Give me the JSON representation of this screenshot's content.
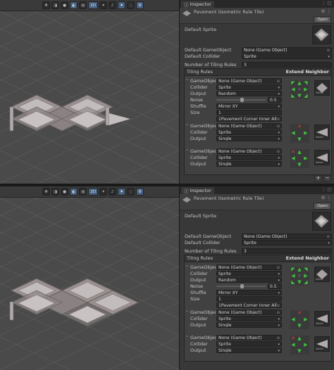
{
  "toolbar": {
    "buttons": [
      {
        "icon": "move-icon",
        "glyph": "✥"
      },
      {
        "icon": "draw-mode-icon",
        "glyph": "◨"
      },
      {
        "icon": "sphere-icon",
        "glyph": "●"
      },
      {
        "icon": "moon-icon",
        "glyph": "◐"
      },
      {
        "icon": "layers-icon",
        "glyph": "▤"
      },
      {
        "label": "2D"
      },
      {
        "icon": "lighting-icon",
        "glyph": "✦"
      },
      {
        "icon": "audio-icon",
        "glyph": "♪"
      },
      {
        "icon": "fx-icon",
        "glyph": "✷"
      },
      {
        "icon": "hidden-icon",
        "glyph": "◌"
      },
      {
        "icon": "gizmo-icon",
        "glyph": "⚙"
      }
    ]
  },
  "inspector": {
    "tab_title": "Inspector",
    "asset_title": "Pavement (Isometric Rule Tile)",
    "open_label": "Open",
    "default_sprite_label": "Default Sprite",
    "default_gameobject_label": "Default GameObject",
    "default_gameobject_value": "None (Game Object)",
    "default_collider_label": "Default Collider",
    "default_collider_value": "Sprite",
    "num_rules_label": "Number of Tiling Rules",
    "num_rules_value": "3",
    "tiling_rules_label": "Tiling Rules",
    "extend_neighbor_label": "Extend Neighbor",
    "select_label": "Select",
    "rules": [
      {
        "fields": [
          {
            "label": "GameObject",
            "value": "None (Game Object)"
          },
          {
            "label": "Collider",
            "value": "Sprite"
          },
          {
            "label": "Output",
            "value": "Random"
          },
          {
            "label": "Noise",
            "value": "0.5"
          },
          {
            "label": "Shuffle",
            "value": "Mirror XY"
          },
          {
            "label": "Size",
            "value": "1"
          }
        ],
        "sprite_entry": "1Pavement Corner Inner All"
      },
      {
        "fields": [
          {
            "label": "GameObject",
            "value": "None (Game Object)"
          },
          {
            "label": "Collider",
            "value": "Sprite"
          },
          {
            "label": "Output",
            "value": "Single"
          }
        ]
      },
      {
        "fields": [
          {
            "label": "GameObject",
            "value": "None (Game Object)"
          },
          {
            "label": "Collider",
            "value": "Sprite"
          },
          {
            "label": "Output",
            "value": "Single"
          }
        ]
      }
    ],
    "add_label": "+",
    "remove_label": "−"
  }
}
